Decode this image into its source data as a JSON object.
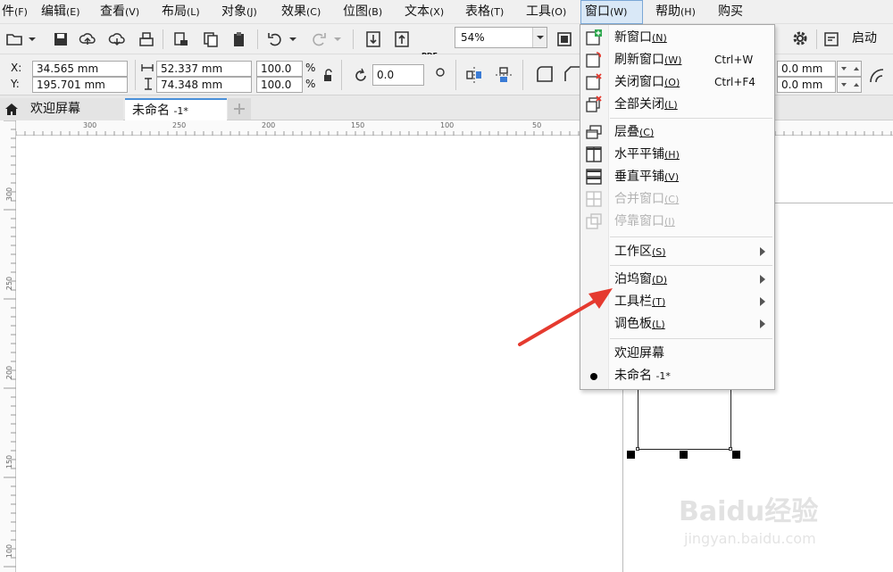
{
  "menubar": {
    "items": [
      {
        "label": "件",
        "key": "(F)"
      },
      {
        "label": "编辑",
        "key": "(E)"
      },
      {
        "label": "查看",
        "key": "(V)"
      },
      {
        "label": "布局",
        "key": "(L)"
      },
      {
        "label": "对象",
        "key": "(J)"
      },
      {
        "label": "效果",
        "key": "(C)"
      },
      {
        "label": "位图",
        "key": "(B)"
      },
      {
        "label": "文本",
        "key": "(X)"
      },
      {
        "label": "表格",
        "key": "(T)"
      },
      {
        "label": "工具",
        "key": "(O)"
      },
      {
        "label": "窗口",
        "key": "(W)"
      },
      {
        "label": "帮助",
        "key": "(H)"
      },
      {
        "label": "购买",
        "key": ""
      }
    ]
  },
  "toolbar": {
    "zoom_value": "54%",
    "launch_label": "启动",
    "pdf_label": "PDF"
  },
  "properties": {
    "x_label": "X:",
    "y_label": "Y:",
    "x_value": "34.565 mm",
    "y_value": "195.701 mm",
    "width_value": "52.337 mm",
    "height_value": "74.348 mm",
    "scale_x": "100.0",
    "scale_y": "100.0",
    "percent": "%",
    "rotation": "0.0",
    "corner_1": "0.0 mm",
    "corner_2": "0.0 mm"
  },
  "tabs": [
    {
      "label": "欢迎屏幕"
    },
    {
      "label": "未命名",
      "suffix": "-1*"
    }
  ],
  "ruler": {
    "h_ticks": [
      "300",
      "250",
      "200",
      "150",
      "100",
      "50"
    ],
    "v_ticks": [
      "300",
      "250",
      "200",
      "150",
      "100"
    ]
  },
  "window_menu": {
    "items": [
      {
        "label": "新窗口",
        "key": "(N)",
        "shortcut": "",
        "icon": "new-window-icon"
      },
      {
        "label": "刷新窗口",
        "key": "(W)",
        "shortcut": "Ctrl+W",
        "icon": "refresh-window-icon"
      },
      {
        "label": "关闭窗口",
        "key": "(O)",
        "shortcut": "Ctrl+F4",
        "icon": "close-window-icon"
      },
      {
        "label": "全部关闭",
        "key": "(L)",
        "shortcut": "",
        "icon": "close-all-icon"
      },
      {
        "label": "层叠",
        "key": "(C)",
        "shortcut": "",
        "icon": "cascade-icon"
      },
      {
        "label": "水平平铺",
        "key": "(H)",
        "shortcut": "",
        "icon": "tile-horizontal-icon"
      },
      {
        "label": "垂直平铺",
        "key": "(V)",
        "shortcut": "",
        "icon": "tile-vertical-icon"
      },
      {
        "label": "合并窗口",
        "key": "(C)",
        "shortcut": "",
        "icon": "combine-windows-icon",
        "disabled": true
      },
      {
        "label": "停靠窗口",
        "key": "(I)",
        "shortcut": "",
        "icon": "dock-windows-icon",
        "disabled": true
      },
      {
        "label": "工作区",
        "key": "(S)",
        "submenu": true
      },
      {
        "label": "泊坞窗",
        "key": "(D)",
        "submenu": true
      },
      {
        "label": "工具栏",
        "key": "(T)",
        "submenu": true
      },
      {
        "label": "调色板",
        "key": "(L)",
        "submenu": true
      },
      {
        "label": "欢迎屏幕",
        "key": ""
      },
      {
        "label": "未命名",
        "key": "",
        "suffix": "-1*",
        "checked": true
      }
    ]
  },
  "watermark": {
    "text": "Baidu经验",
    "url": "jingyan.baidu.com"
  },
  "colors": {
    "accent": "#4a90d9",
    "arrow": "#e53a2f"
  }
}
